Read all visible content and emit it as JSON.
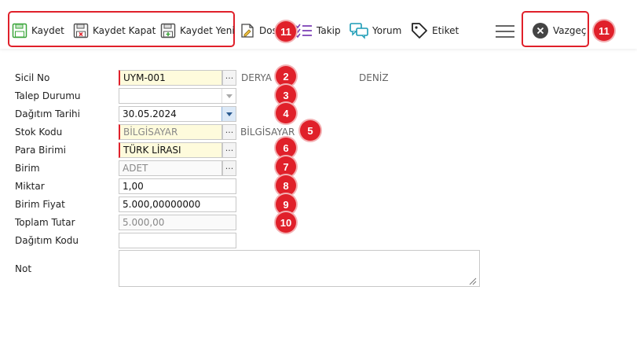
{
  "toolbar": {
    "save": "Kaydet",
    "save_close": "Kaydet Kapat",
    "save_new": "Kaydet Yeni",
    "file": "Dosy",
    "follow": "Takip",
    "comment": "Yorum",
    "tag": "Etiket",
    "cancel": "Vazgeç"
  },
  "badges": [
    "11",
    "2",
    "3",
    "4",
    "5",
    "6",
    "7",
    "8",
    "9",
    "10",
    "11"
  ],
  "form": {
    "sicil_no": {
      "label": "Sicil No",
      "value": "UYM-001",
      "side1": "DERYA",
      "side2": "DENİZ"
    },
    "talep_durumu": {
      "label": "Talep Durumu",
      "value": ""
    },
    "dagitim_tarihi": {
      "label": "Dağıtım Tarihi",
      "value": "30.05.2024"
    },
    "stok_kodu": {
      "label": "Stok Kodu",
      "value": "BİLGİSAYAR",
      "side": "BİLGİSAYAR"
    },
    "para_birimi": {
      "label": "Para Birimi",
      "value": "TÜRK LİRASI"
    },
    "birim": {
      "label": "Birim",
      "value": "ADET"
    },
    "miktar": {
      "label": "Miktar",
      "value": "1,00"
    },
    "birim_fiyat": {
      "label": "Birim Fiyat",
      "value": "5.000,00000000"
    },
    "toplam_tutar": {
      "label": "Toplam Tutar",
      "value": "5.000,00"
    },
    "dagitim_kodu": {
      "label": "Dağıtım Kodu",
      "value": ""
    },
    "not": {
      "label": "Not",
      "value": ""
    }
  },
  "colors": {
    "accent_red": "#e0202a",
    "required_bg": "#fefbdc",
    "green_icon": "#3aa53a",
    "teal_icon": "#1a9bb5",
    "purple_icon": "#7b3fb5"
  }
}
